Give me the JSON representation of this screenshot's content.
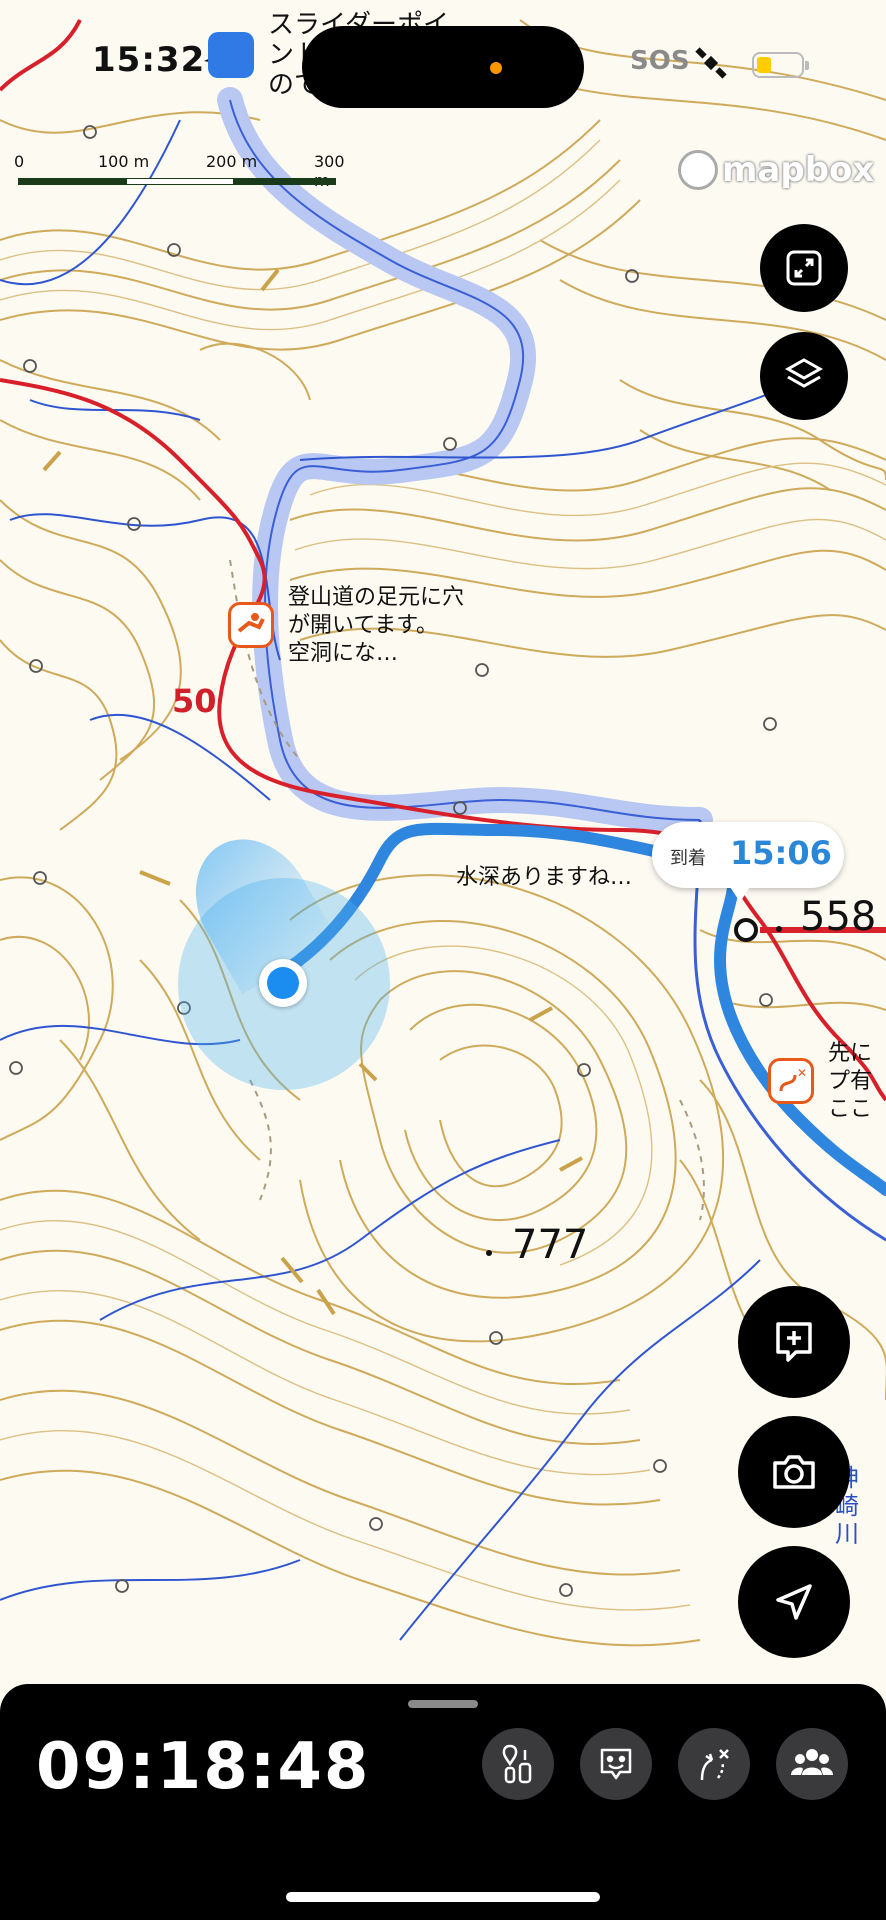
{
  "status_bar": {
    "time": "15:32",
    "sos": "SOS",
    "notification_text": "スライダーポイ\nント…\nので…"
  },
  "map": {
    "scale_labels": [
      "0",
      "100 m",
      "200 m",
      "300 m"
    ],
    "attribution": "mapbox",
    "notes": [
      {
        "text": "登山道の足元に穴\nが開いてます。\n空洞にな…"
      },
      {
        "text": "水深ありますね…"
      },
      {
        "text": "先に\nプ有\nここ"
      }
    ],
    "route_number": "50",
    "elevations": [
      "558",
      "777"
    ],
    "river_name": "神\n崎\n川",
    "arrival": {
      "label": "到着",
      "time": "15:06"
    }
  },
  "fabs": {
    "top": [
      "fullscreen-icon",
      "layers-icon"
    ],
    "bottom": [
      "add-note-icon",
      "camera-icon",
      "locate-icon"
    ]
  },
  "bottom_panel": {
    "elapsed": "09:18:48",
    "tools": [
      "pins-icon",
      "face-icon",
      "route-icon",
      "group-icon"
    ]
  },
  "colors": {
    "contour": "#c9a24a",
    "contour_minor": "#dcc083",
    "river": "#b9c8f2",
    "stream": "#2f56d0",
    "trail": "#d7202a",
    "track": "#2e86de",
    "accent_orange": "#e8581b"
  }
}
